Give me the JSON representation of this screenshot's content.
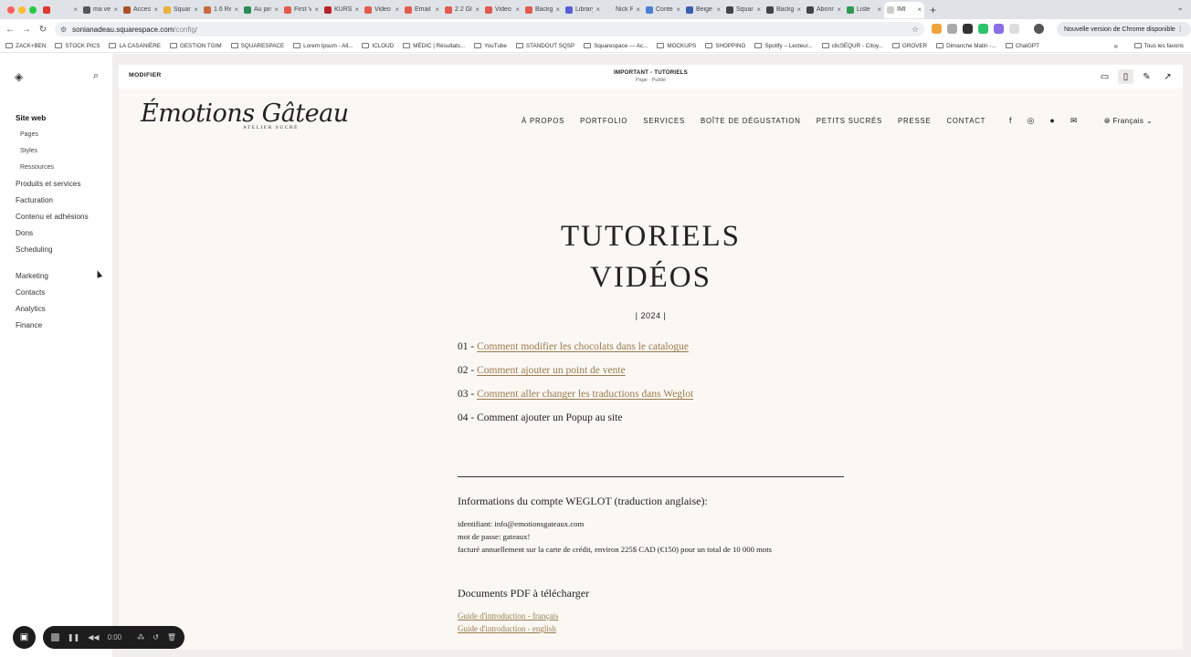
{
  "browser": {
    "tabs": [
      {
        "title": "",
        "color": "#e0382c"
      },
      {
        "title": "ma ve",
        "color": "#555555"
      },
      {
        "title": "Acces",
        "color": "#b0502a"
      },
      {
        "title": "Squar",
        "color": "#e8b23a"
      },
      {
        "title": "1.6 Re",
        "color": "#c96a3a"
      },
      {
        "title": "Au jard",
        "color": "#2e8b57"
      },
      {
        "title": "First V",
        "color": "#e25b4f"
      },
      {
        "title": "KURSZ",
        "color": "#b8212c"
      },
      {
        "title": "Video",
        "color": "#e25b4f"
      },
      {
        "title": "Email /",
        "color": "#e25b4f"
      },
      {
        "title": "2.2 Gl",
        "color": "#e25b4f"
      },
      {
        "title": "Video",
        "color": "#e25b4f"
      },
      {
        "title": "Backg",
        "color": "#e25b4f"
      },
      {
        "title": "Library",
        "color": "#5b5fd6"
      },
      {
        "title": "Nick P",
        "color": "#e0e0e0"
      },
      {
        "title": "Conte",
        "color": "#4a7fd6"
      },
      {
        "title": "Beige",
        "color": "#3a5fb0"
      },
      {
        "title": "Squar",
        "color": "#444444"
      },
      {
        "title": "Backg",
        "color": "#444444"
      },
      {
        "title": "Abonn",
        "color": "#444444"
      },
      {
        "title": "Liste",
        "color": "#2e9b4f"
      },
      {
        "title": "IMI",
        "color": "#cccccc"
      }
    ],
    "url_host": "sonianadeau.squarespace.com",
    "url_path": "/config/",
    "update_label": "Nouvelle version de Chrome disponible",
    "bookmarks": [
      "ZACK+BEN",
      "STOCK PICS",
      "LA CASANIÈRE",
      "GESTION TGIM",
      "SQUARESPACE",
      "Lorem Ipsum - All...",
      "ICLOUD",
      "MÉDIC | Résultats...",
      "YouTube",
      "STANDOUT SQSP",
      "Squarespace — Ac...",
      "MOCKUPS",
      "SHOPPING",
      "Spotify – Lecteur...",
      "clicSÉQUR - Citoy...",
      "GROVER",
      "Dimanche Matin -...",
      "ChatGPT"
    ],
    "bookmarks_all": "Tous les favoris"
  },
  "sidebar": {
    "site_web": "Site web",
    "sub": [
      "Pages",
      "Styles",
      "Ressources"
    ],
    "group1": [
      "Produits et services",
      "Facturation",
      "Contenu et adhésions",
      "Dons",
      "Scheduling"
    ],
    "group2": [
      "Marketing",
      "Contacts",
      "Analytics",
      "Finance"
    ]
  },
  "editor": {
    "modifier": "MODIFIER",
    "page_title": "IMPORTANT - TUTORIELS",
    "page_status": "Page · Publié"
  },
  "site": {
    "logo": "Émotions Gâteau",
    "logo_sub": "ATELIER SUCRÉ",
    "nav": [
      "À PROPOS",
      "PORTFOLIO",
      "SERVICES",
      "BOÎTE DE DÉGUSTATION",
      "PETITS SUCRÉS",
      "PRESSE",
      "CONTACT"
    ],
    "language": "Français",
    "hero_line1": "TUTORIELS",
    "hero_line2": "VIDÉOS",
    "year": "| 2024 |",
    "tutorials": [
      {
        "num": "01 - ",
        "text": "Comment modifier les chocolats dans le catalogue",
        "link": true
      },
      {
        "num": "02 - ",
        "text": "Comment ajouter un point de vente",
        "link": true
      },
      {
        "num": "03 - ",
        "text": "Comment aller changer les traductions dans Weglot",
        "link": true
      },
      {
        "num": "04 - ",
        "text": "Comment ajouter un Popup au site",
        "link": false
      }
    ],
    "weglot_title": "Informations du compte WEGLOT (traduction anglaise):",
    "weglot_lines": [
      "identifiant: info@emotionsgateaux.com",
      "mot de passe: gateaux!",
      "facturé annuellement sur la carte de crédit, environ 225$ CAD (€150) pour un total de 10 000 mots"
    ],
    "pdf_title": "Documents PDF à télécharger",
    "pdf_links": [
      "Guide d'introduction - français",
      "Guide d'introduction - english"
    ]
  },
  "recorder": {
    "time": "0:00"
  }
}
